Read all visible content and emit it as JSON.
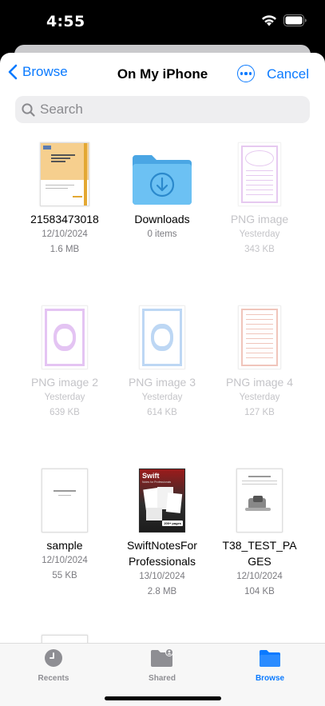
{
  "status": {
    "time": "4:55"
  },
  "nav": {
    "back_label": "Browse",
    "title": "On My iPhone",
    "cancel_label": "Cancel"
  },
  "search": {
    "placeholder": "Search"
  },
  "files": [
    {
      "name": "21583473018",
      "date": "12/10/2024",
      "size": "1.6 MB"
    },
    {
      "name": "Downloads",
      "date": "0 items",
      "size": ""
    },
    {
      "name": "PNG image",
      "date": "Yesterday",
      "size": "343 KB"
    },
    {
      "name": "PNG image 2",
      "date": "Yesterday",
      "size": "639 KB"
    },
    {
      "name": "PNG image 3",
      "date": "Yesterday",
      "size": "614 KB"
    },
    {
      "name": "PNG image 4",
      "date": "Yesterday",
      "size": "127 KB"
    },
    {
      "name": "sample",
      "date": "12/10/2024",
      "size": "55 KB"
    },
    {
      "name": "SwiftNotesFor Professionals",
      "date": "13/10/2024",
      "size": "2.8 MB"
    },
    {
      "name": "T38_TEST_PA GES",
      "date": "12/10/2024",
      "size": "104 KB"
    }
  ],
  "swift_cover": {
    "title": "Swift",
    "subtitle": "Notes for Professionals",
    "badge": "200+ pages"
  },
  "tabs": [
    {
      "label": "Recents"
    },
    {
      "label": "Shared"
    },
    {
      "label": "Browse"
    }
  ],
  "colors": {
    "accent": "#0a7aff",
    "folder": "#5ab6ee",
    "tab_inactive": "#8e8e93",
    "faded_text": "#c4c4c8"
  }
}
